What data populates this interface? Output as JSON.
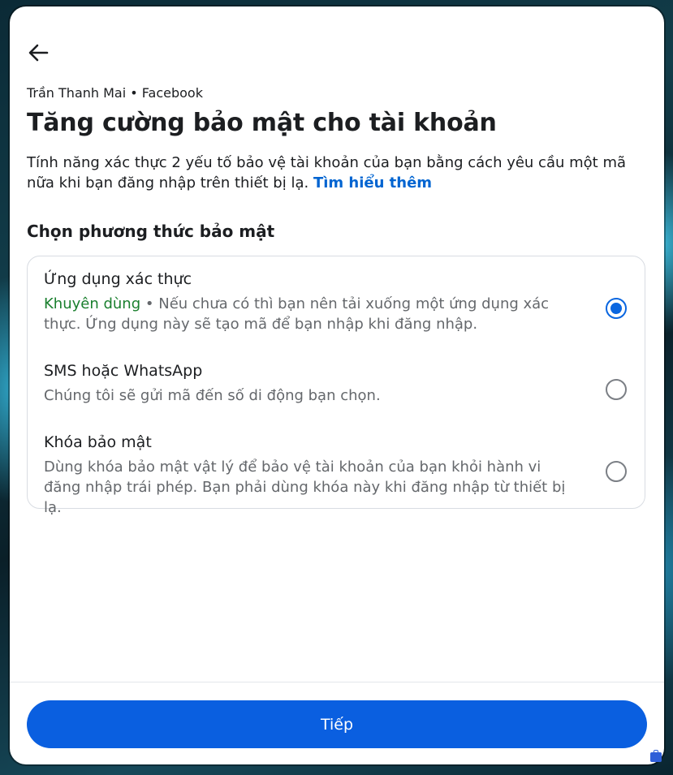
{
  "header": {
    "account_line": "Trần Thanh Mai • Facebook",
    "title": "Tăng cường bảo mật cho tài khoản",
    "description": "Tính năng xác thực 2 yếu tố bảo vệ tài khoản của bạn bằng cách yêu cầu một mã nữa khi bạn đăng nhập trên thiết bị lạ.",
    "learn_more": "Tìm hiểu thêm"
  },
  "section": {
    "heading": "Chọn phương thức bảo mật"
  },
  "options": [
    {
      "title": "Ứng dụng xác thực",
      "recommended": "Khuyên dùng",
      "description": "• Nếu chưa có thì bạn nên tải xuống một ứng dụng xác thực. Ứng dụng này sẽ tạo mã để bạn nhập khi đăng nhập.",
      "selected": true
    },
    {
      "title": "SMS hoặc WhatsApp",
      "description": "Chúng tôi sẽ gửi mã đến số di động bạn chọn.",
      "selected": false
    },
    {
      "title": "Khóa bảo mật",
      "description": "Dùng khóa bảo mật vật lý để bảo vệ tài khoản của bạn khỏi hành vi đăng nhập trái phép. Bạn phải dùng khóa này khi đăng nhập từ thiết bị lạ.",
      "selected": false
    }
  ],
  "footer": {
    "continue_label": "Tiếp"
  },
  "colors": {
    "accent": "#0a5fe0",
    "link": "#0064d1",
    "recommended": "#1a7f2e",
    "secondary_text": "#65686c"
  },
  "icons": {
    "back": "arrow-left-icon",
    "tray": "briefcase-icon"
  }
}
